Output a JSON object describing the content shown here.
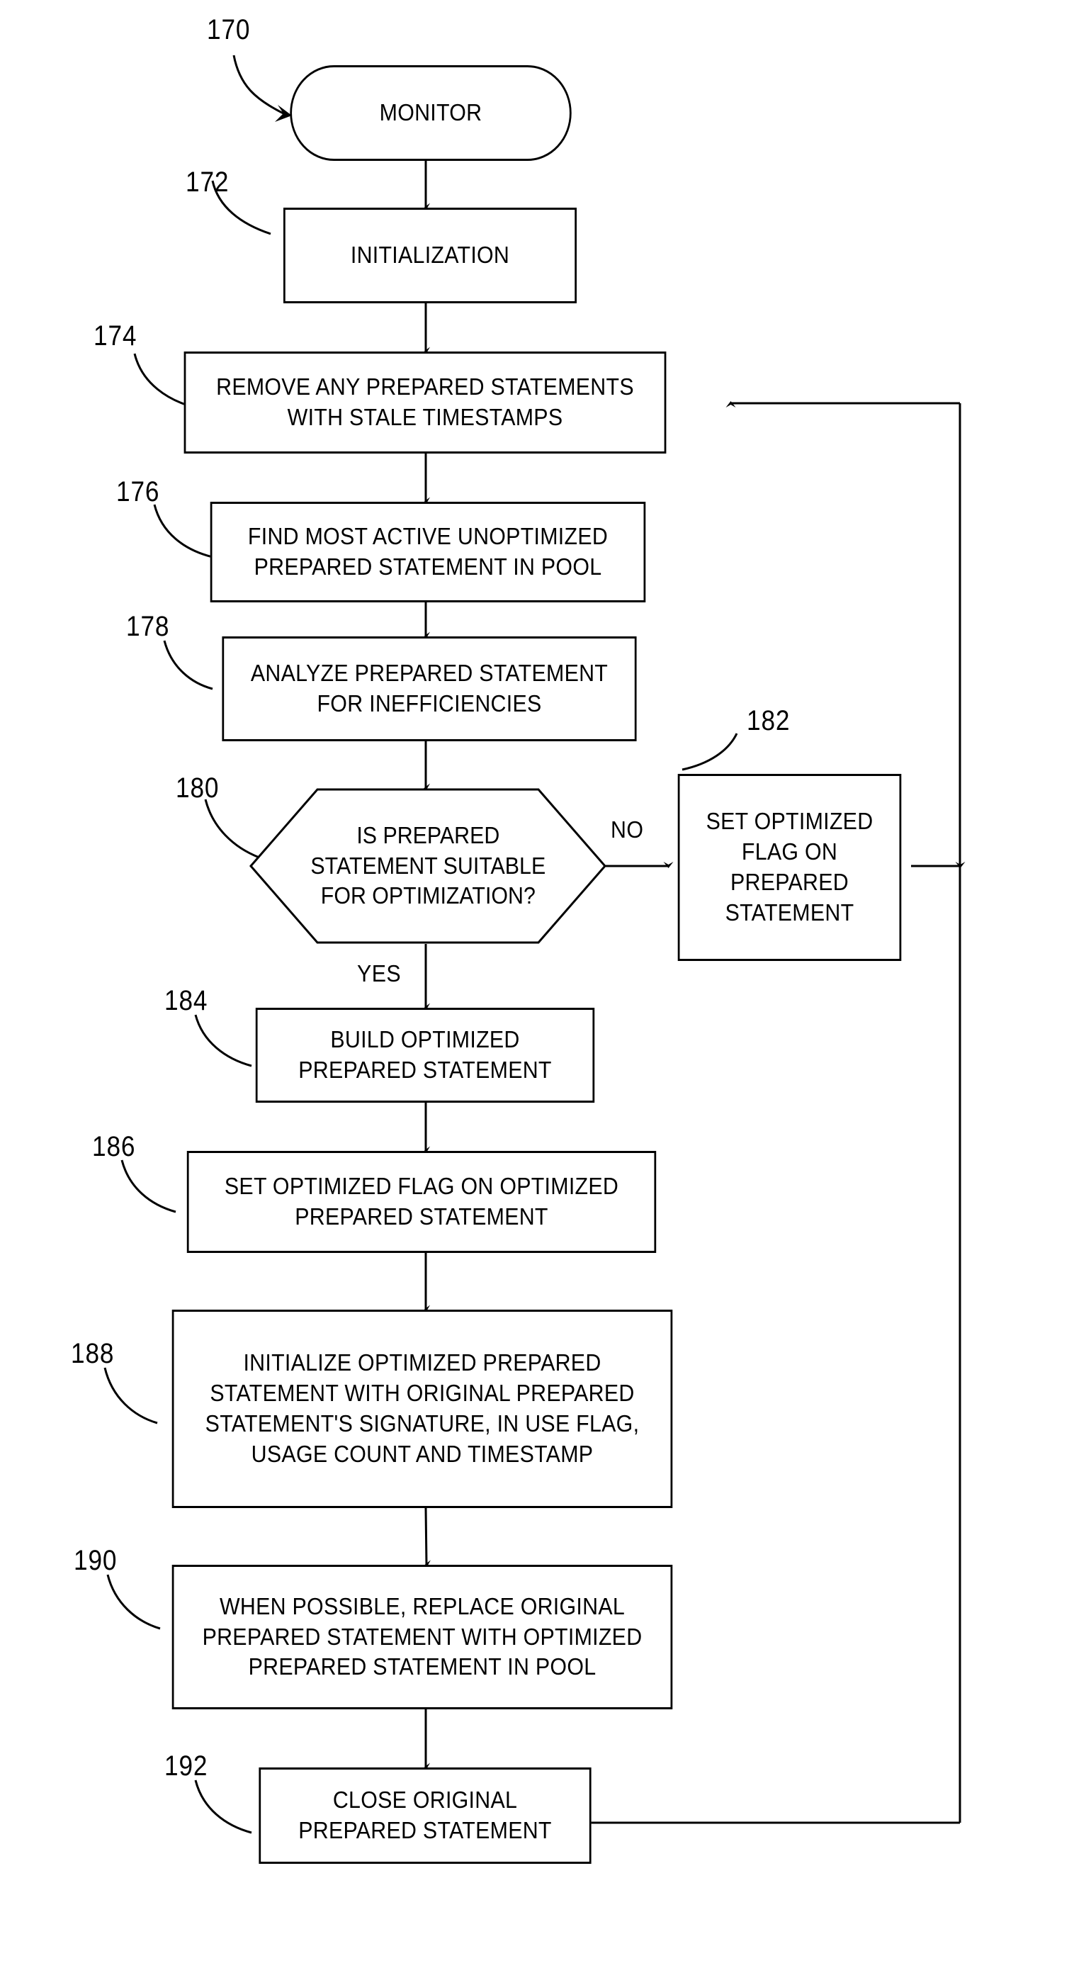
{
  "figure": {
    "type": "patent-flowchart",
    "title_text": "",
    "background_color": "#ffffff",
    "ink_color": "#000000"
  },
  "nodes": [
    {
      "id": "monitor",
      "ref": "170",
      "shape": "terminal",
      "text": "MONITOR"
    },
    {
      "id": "initialization",
      "ref": "172",
      "shape": "process",
      "text": "INITIALIZATION"
    },
    {
      "id": "remove_stale",
      "ref": "174",
      "shape": "process",
      "text": "REMOVE ANY PREPARED STATEMENTS\nWITH STALE TIMESTAMPS"
    },
    {
      "id": "find_active",
      "ref": "176",
      "shape": "process",
      "text": "FIND MOST ACTIVE UNOPTIMIZED\nPREPARED STATEMENT IN POOL"
    },
    {
      "id": "analyze",
      "ref": "178",
      "shape": "process",
      "text": "ANALYZE PREPARED STATEMENT\nFOR INEFFICIENCIES"
    },
    {
      "id": "decision_suitable",
      "ref": "180",
      "shape": "decision-hexagon",
      "text": "IS PREPARED\nSTATEMENT SUITABLE\nFOR OPTIMIZATION?"
    },
    {
      "id": "set_flag_no",
      "ref": "182",
      "shape": "process",
      "text": "SET OPTIMIZED\nFLAG ON\nPREPARED\nSTATEMENT"
    },
    {
      "id": "build_optimized",
      "ref": "184",
      "shape": "process",
      "text": "BUILD OPTIMIZED\nPREPARED STATEMENT"
    },
    {
      "id": "set_flag_optimized",
      "ref": "186",
      "shape": "process",
      "text": "SET OPTIMIZED FLAG ON OPTIMIZED\nPREPARED  STATEMENT"
    },
    {
      "id": "initialize_optimized",
      "ref": "188",
      "shape": "process",
      "text": "INITIALIZE OPTIMIZED PREPARED\nSTATEMENT WITH ORIGINAL PREPARED\nSTATEMENT'S SIGNATURE, IN USE FLAG,\nUSAGE COUNT AND TIMESTAMP"
    },
    {
      "id": "replace_original",
      "ref": "190",
      "shape": "process",
      "text": "WHEN POSSIBLE, REPLACE ORIGINAL\nPREPARED STATEMENT WITH OPTIMIZED\nPREPARED STATEMENT IN POOL"
    },
    {
      "id": "close_original",
      "ref": "192",
      "shape": "process",
      "text": "CLOSE ORIGINAL\nPREPARED STATEMENT"
    }
  ],
  "edge_labels": [
    {
      "id": "no_label",
      "text": "NO"
    },
    {
      "id": "yes_label",
      "text": "YES"
    }
  ],
  "reference_numerals": [
    "170",
    "172",
    "174",
    "176",
    "178",
    "180",
    "182",
    "184",
    "186",
    "188",
    "190",
    "192"
  ]
}
